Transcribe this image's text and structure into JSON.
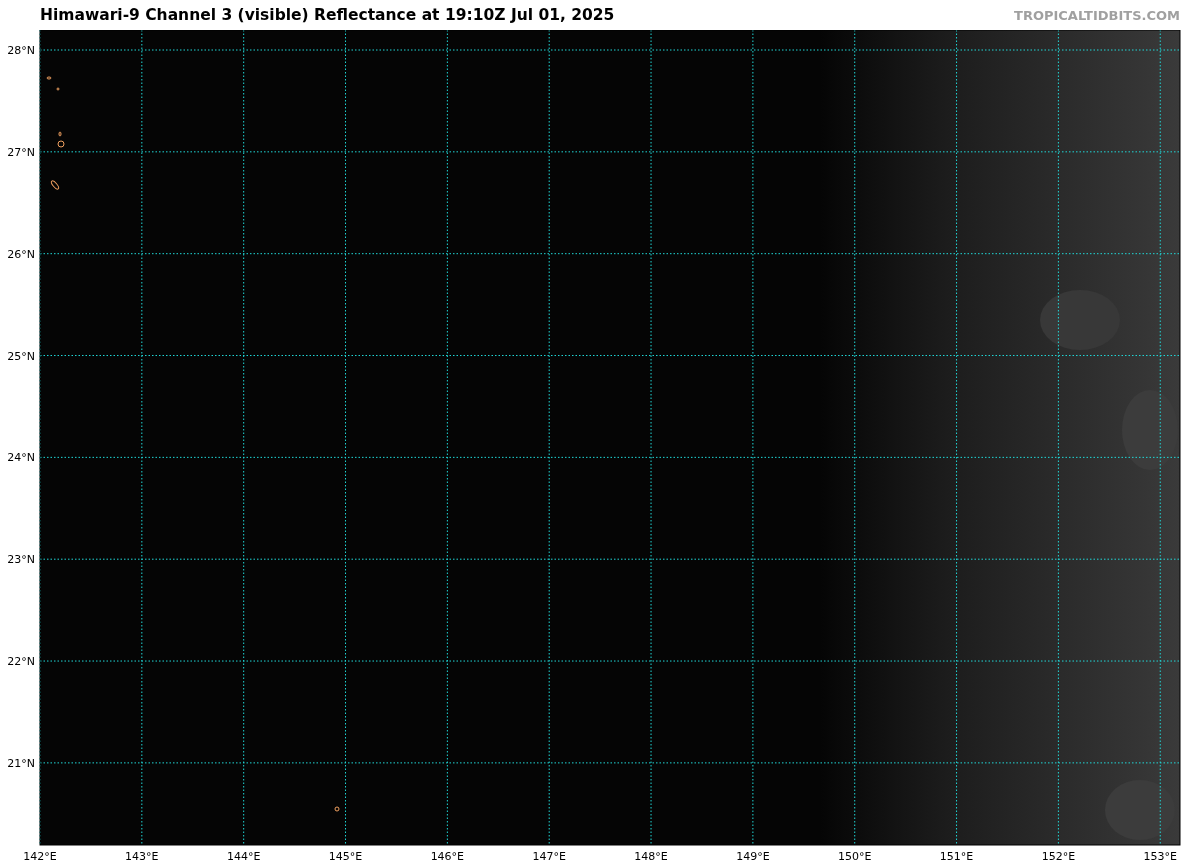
{
  "title": "Himawari-9 Channel 3 (visible) Reflectance at 19:10Z Jul 01, 2025",
  "credit": "TROPICALTIDBITS.COM",
  "map": {
    "latitude_labels": [
      "28°N",
      "27°N",
      "26°N",
      "25°N",
      "24°N",
      "23°N",
      "22°N",
      "21°N"
    ],
    "longitude_labels": [
      "142°E",
      "143°E",
      "144°E",
      "145°E",
      "146°E",
      "147°E",
      "148°E",
      "149°E",
      "150°E",
      "151°E",
      "152°E",
      "153°E"
    ]
  }
}
